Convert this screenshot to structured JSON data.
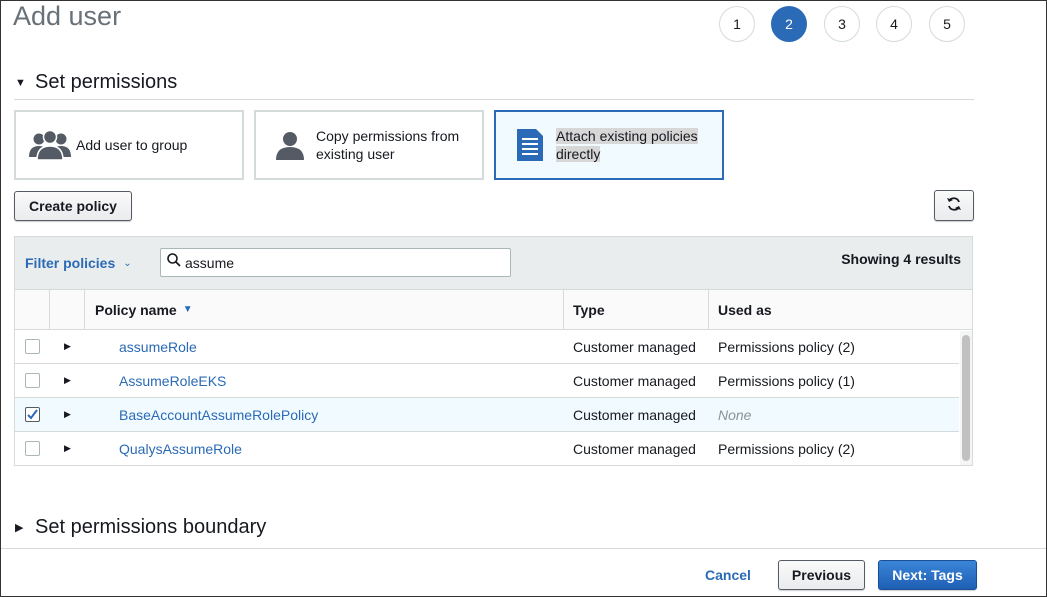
{
  "page_title": "Add user",
  "steps": [
    {
      "label": "1",
      "active": false
    },
    {
      "label": "2",
      "active": true
    },
    {
      "label": "3",
      "active": false
    },
    {
      "label": "4",
      "active": false
    },
    {
      "label": "5",
      "active": false
    }
  ],
  "permissions": {
    "heading": "Set permissions",
    "options": [
      {
        "label": "Add user to group",
        "icon": "user-group-icon",
        "selected": false
      },
      {
        "label": "Copy permissions from existing user",
        "icon": "user-icon",
        "selected": false
      },
      {
        "label": "Attach existing policies directly",
        "icon": "document-icon",
        "selected": true
      }
    ],
    "create_policy_label": "Create policy",
    "refresh_icon": "refresh-icon"
  },
  "table": {
    "filter_label": "Filter policies",
    "search_value": "assume",
    "result_count": "Showing 4 results",
    "columns": {
      "name": "Policy name",
      "type": "Type",
      "used_as": "Used as"
    },
    "rows": [
      {
        "name": "assumeRole",
        "type": "Customer managed",
        "used_as": "Permissions policy (2)",
        "checked": false
      },
      {
        "name": "AssumeRoleEKS",
        "type": "Customer managed",
        "used_as": "Permissions policy (1)",
        "checked": false
      },
      {
        "name": "BaseAccountAssumeRolePolicy",
        "type": "Customer managed",
        "used_as": "None",
        "checked": true
      },
      {
        "name": "QualysAssumeRole",
        "type": "Customer managed",
        "used_as": "Permissions policy (2)",
        "checked": false
      }
    ]
  },
  "boundary": {
    "heading": "Set permissions boundary"
  },
  "footer": {
    "cancel": "Cancel",
    "previous": "Previous",
    "next": "Next: Tags"
  },
  "colors": {
    "accent": "#2a6ab6",
    "selected_bg": "#f1faff",
    "border": "#d5dbdb"
  }
}
